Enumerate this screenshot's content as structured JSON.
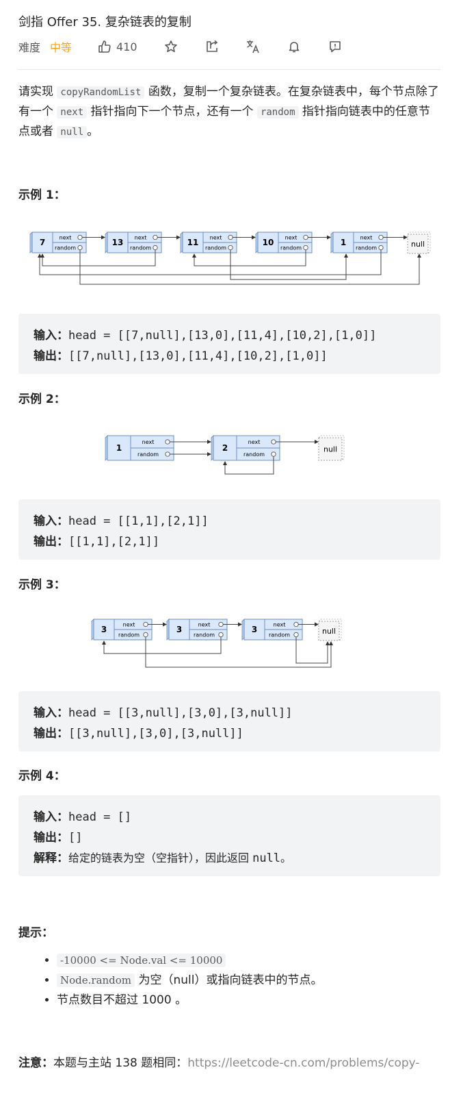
{
  "header": {
    "title": "剑指 Offer 35. 复杂链表的复制",
    "difficulty_label": "难度",
    "difficulty_value": "中等",
    "likes": "410"
  },
  "description": {
    "p1_a": "请实现 ",
    "code_copy": "copyRandomList",
    "p1_b": " 函数，复制一个复杂链表。在复杂链表中，每个节点除了有一个 ",
    "code_next": "next",
    "p1_c": " 指针指向下一个节点，还有一个 ",
    "code_random": "random",
    "p1_d": " 指针指向链表中的任意节点或者 ",
    "code_null": "null",
    "p1_e": "。"
  },
  "diagram_labels": {
    "next": "next",
    "random": "random",
    "null": "null"
  },
  "examples": [
    {
      "heading": "示例 1：",
      "nodes": [
        "7",
        "13",
        "11",
        "10",
        "1"
      ],
      "input_label": "输入：",
      "input_value": "head = [[7,null],[13,0],[11,4],[10,2],[1,0]]",
      "output_label": "输出：",
      "output_value": "[[7,null],[13,0],[11,4],[10,2],[1,0]]"
    },
    {
      "heading": "示例 2：",
      "nodes": [
        "1",
        "2"
      ],
      "input_label": "输入：",
      "input_value": "head = [[1,1],[2,1]]",
      "output_label": "输出：",
      "output_value": "[[1,1],[2,1]]"
    },
    {
      "heading": "示例 3：",
      "nodes": [
        "3",
        "3",
        "3"
      ],
      "input_label": "输入：",
      "input_value": "head = [[3,null],[3,0],[3,null]]",
      "output_label": "输出：",
      "output_value": "[[3,null],[3,0],[3,null]]"
    },
    {
      "heading": "示例 4：",
      "input_label": "输入：",
      "input_value": "head = []",
      "output_label": "输出：",
      "output_value": "[]",
      "explain_label": "解释：",
      "explain_value": "给定的链表为空（空指针），因此返回 ",
      "explain_code": "null",
      "explain_end": "。"
    }
  ],
  "tips": {
    "heading": "提示：",
    "items": [
      {
        "code": "-10000 <= Node.val <= 10000",
        "text": ""
      },
      {
        "code": "Node.random",
        "text": " 为空（null）或指向链表中的节点。"
      },
      {
        "code": "",
        "text": "节点数目不超过 1000 。"
      }
    ]
  },
  "note": {
    "label": "注意：",
    "text": "本题与主站 138 题相同：",
    "link": "https://leetcode-cn.com/problems/copy-"
  },
  "colors": {
    "accent_medium": "#ffa116",
    "node_fill": "#dae8fc",
    "node_stroke": "#6c8ebf",
    "null_fill": "#f5f5f5",
    "code_bg": "#f2f3f4"
  },
  "icons": [
    "thumbs-up-icon",
    "star-icon",
    "share-icon",
    "translate-icon",
    "bell-icon",
    "feedback-icon"
  ]
}
